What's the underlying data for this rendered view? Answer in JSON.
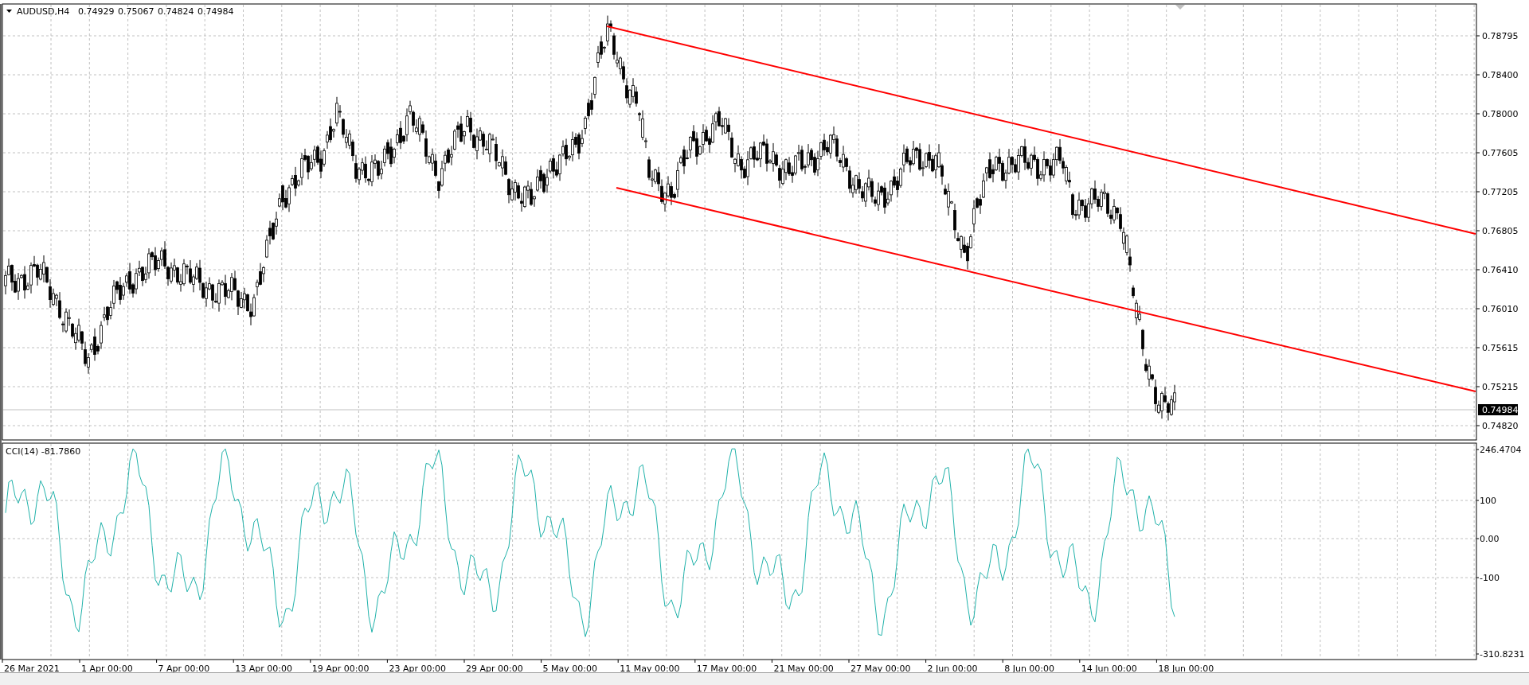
{
  "chart": {
    "symbol": "AUDUSD,H4",
    "ohlc": [
      "0.74929",
      "0.75067",
      "0.74824",
      "0.74984"
    ],
    "price_axis": [
      "0.78795",
      "0.78400",
      "0.78000",
      "0.77605",
      "0.77205",
      "0.76805",
      "0.76410",
      "0.76010",
      "0.75615",
      "0.75215",
      "0.74820"
    ],
    "current_price": "0.74984"
  },
  "indicator": {
    "label": "CCI(14) -81.7860",
    "axis": [
      "246.4704",
      "100",
      "0.00",
      "-100",
      "-310.8231"
    ]
  },
  "time_axis": [
    "26 Mar 2021",
    "1 Apr 00:00",
    "7 Apr 00:00",
    "13 Apr 00:00",
    "19 Apr 00:00",
    "23 Apr 00:00",
    "29 Apr 00:00",
    "5 May 00:00",
    "11 May 00:00",
    "17 May 00:00",
    "21 May 00:00",
    "27 May 00:00",
    "2 Jun 00:00",
    "8 Jun 00:00",
    "14 Jun 00:00",
    "18 Jun 00:00"
  ]
}
